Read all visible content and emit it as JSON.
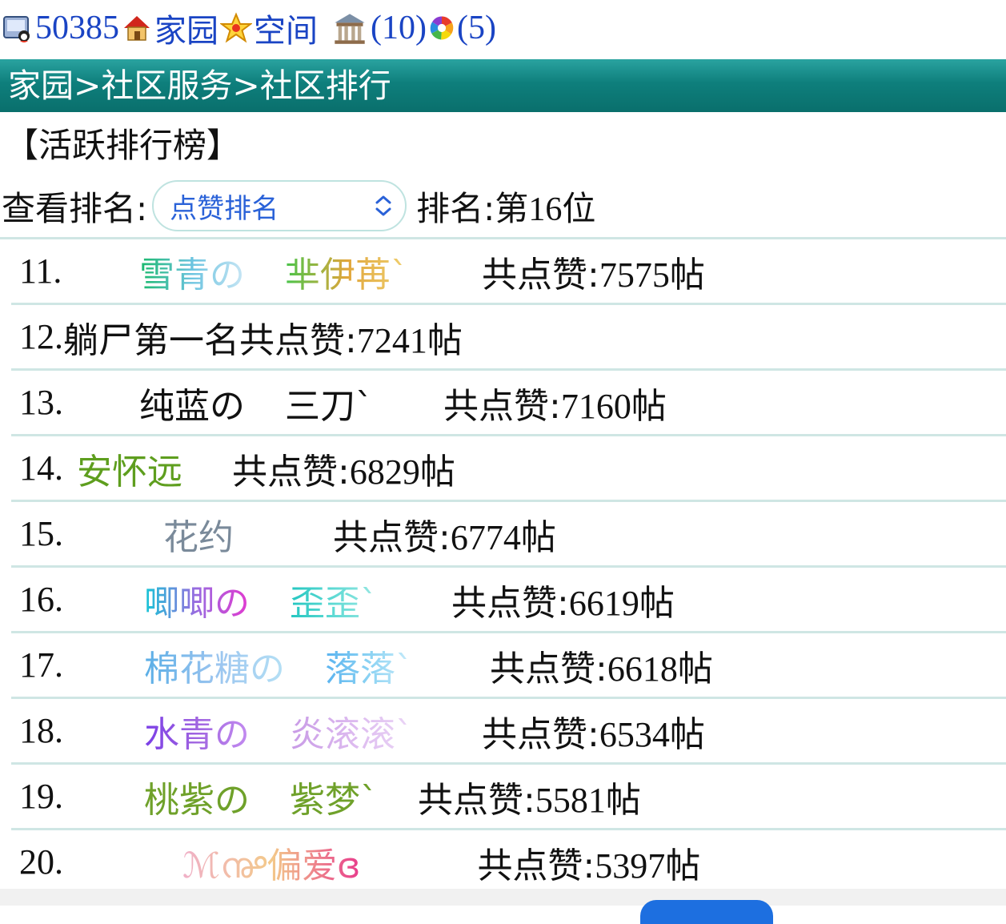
{
  "top_bar": {
    "user_id": "50385",
    "home_label": "家园",
    "space_label": "空间",
    "building_count": "(10)",
    "photo_count": "(5)"
  },
  "breadcrumb": "家园>社区服务>社区排行",
  "section_title": "【活跃排行榜】",
  "view_rank": {
    "label": "查看排名:",
    "selected_option": "点赞排名",
    "my_rank_label": "排名:第",
    "my_rank_value": "16",
    "my_rank_suffix": "位"
  },
  "rankings": [
    {
      "index": "11.",
      "name_a": "雪青の",
      "name_b": "芈伊苒ˋ",
      "likes_label": "共点赞:",
      "likes": "7575",
      "unit": "帖"
    },
    {
      "index": "12.",
      "name_a": "躺尸第一名",
      "name_b": "",
      "likes_label": "共点赞:",
      "likes": "7241",
      "unit": "帖"
    },
    {
      "index": "13.",
      "name_a": "纯蓝の",
      "name_b": "三刀ˋ",
      "likes_label": "共点赞:",
      "likes": "7160",
      "unit": "帖"
    },
    {
      "index": "14.",
      "name_a": "安怀远",
      "name_b": "",
      "likes_label": "共点赞:",
      "likes": "6829",
      "unit": "帖"
    },
    {
      "index": "15.",
      "name_a": "花约",
      "name_b": "",
      "likes_label": "共点赞:",
      "likes": "6774",
      "unit": "帖"
    },
    {
      "index": "16.",
      "name_a": "唧唧の",
      "name_b": "歪歪ˋ",
      "likes_label": "共点赞:",
      "likes": "6619",
      "unit": "帖"
    },
    {
      "index": "17.",
      "name_a": "棉花糖の",
      "name_b": "落落ˋ",
      "likes_label": "共点赞:",
      "likes": "6618",
      "unit": "帖"
    },
    {
      "index": "18.",
      "name_a": "水青の",
      "name_b": "炎滚滚ˋ",
      "likes_label": "共点赞:",
      "likes": "6534",
      "unit": "帖"
    },
    {
      "index": "19.",
      "name_a": "桃紫の",
      "name_b": "紫梦ˋ",
      "likes_label": "共点赞:",
      "likes": "5581",
      "unit": "帖"
    },
    {
      "index": "20.",
      "name_a": "ℳ൲偏爱ɞ",
      "name_b": "",
      "likes_label": "共点赞:",
      "likes": "5397",
      "unit": "帖"
    }
  ],
  "colors": {
    "link_blue": "#1a44c4",
    "header_teal": "#0e7f7c",
    "divider": "#cfe6e4",
    "select_text": "#2a62d8"
  }
}
